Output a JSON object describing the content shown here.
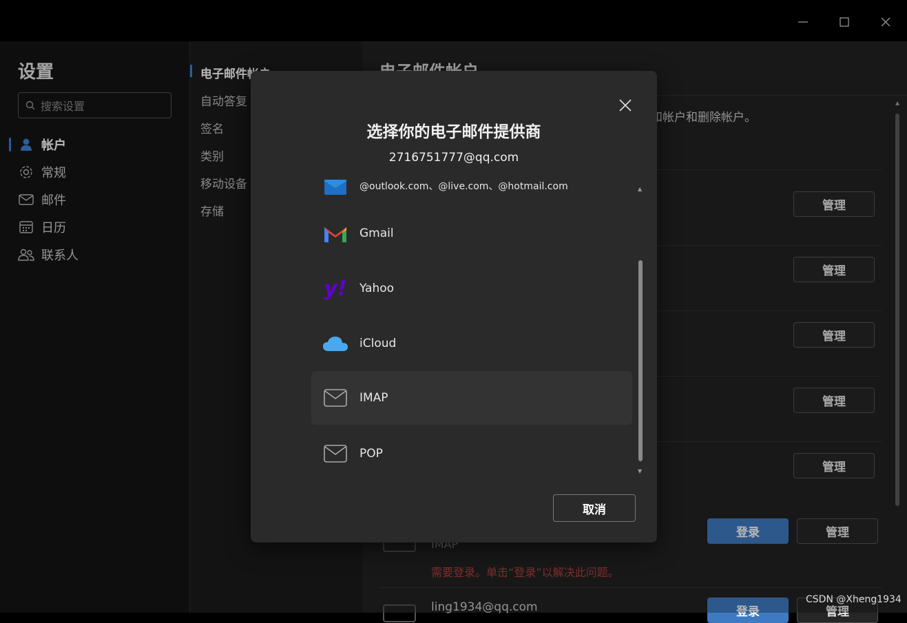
{
  "nav": {
    "title": "设置",
    "search_placeholder": "搜索设置",
    "items": [
      {
        "label": "帐户",
        "icon": "person-icon",
        "active": true
      },
      {
        "label": "常规",
        "icon": "gear-icon"
      },
      {
        "label": "邮件",
        "icon": "mail-icon"
      },
      {
        "label": "日历",
        "icon": "calendar-icon"
      },
      {
        "label": "联系人",
        "icon": "people-icon"
      }
    ]
  },
  "subnav": {
    "items": [
      {
        "label": "电子邮件帐户",
        "active": true
      },
      {
        "label": "自动答复"
      },
      {
        "label": "签名"
      },
      {
        "label": "类别"
      },
      {
        "label": "移动设备"
      },
      {
        "label": "存储"
      }
    ]
  },
  "main": {
    "title": "电子邮件帐户",
    "desc": "和帐户和删除帐户。",
    "manage_label": "管理",
    "login_label": "登录",
    "account_type": "IMAP",
    "account_warning": "需要登录。单击“登录”以解决此问题。",
    "account_name": "ling1934@qq.com"
  },
  "dialog": {
    "title": "选择你的电子邮件提供商",
    "email": "2716751777@qq.com",
    "providers": [
      {
        "label": "@outlook.com、@live.com、@hotmail.com",
        "icon": "outlook-icon"
      },
      {
        "label": "Gmail",
        "icon": "gmail-icon"
      },
      {
        "label": "Yahoo",
        "icon": "yahoo-icon"
      },
      {
        "label": "iCloud",
        "icon": "icloud-icon"
      },
      {
        "label": "IMAP",
        "icon": "mail-envelope-icon",
        "highlighted": true
      },
      {
        "label": "POP",
        "icon": "mail-envelope-icon"
      }
    ],
    "cancel_label": "取消"
  },
  "watermark": "CSDN @Xheng1934",
  "colors": {
    "accent": "#3b82d6",
    "login": "#3d7ac2",
    "warning": "#b0413e"
  }
}
